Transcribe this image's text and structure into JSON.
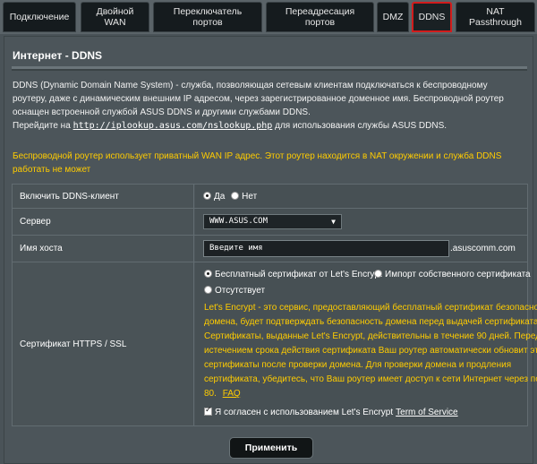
{
  "tabs": [
    {
      "label": "Подключение",
      "active": false
    },
    {
      "label": "Двойной WAN",
      "active": false
    },
    {
      "label": "Переключатель портов",
      "active": false
    },
    {
      "label": "Переадресация портов",
      "active": false
    },
    {
      "label": "DMZ",
      "active": false
    },
    {
      "label": "DDNS",
      "active": true
    },
    {
      "label": "NAT Passthrough",
      "active": false
    }
  ],
  "tab_lines": {
    "t1a": "Двойной",
    "t1b": "WAN",
    "t2a": "Переключатель",
    "t2b": "портов",
    "t3a": "Переадресация",
    "t3b": "портов",
    "t6a": "NAT",
    "t6b": "Passthrough"
  },
  "panel": {
    "title": "Интернет - DDNS",
    "desc_lines": [
      "DDNS (Dynamic Domain Name System) - служба, позволяющая сетевым клиентам подключаться к беспроводному",
      "роутеру, даже с динамическим внешним IP адресом, через зарегистрированное доменное имя. Беспроводной роутер",
      "оснащен встроенной службой ASUS DDNS и другими службами DDNS."
    ],
    "link_prefix": "Перейдите на",
    "link_url": "http://iplookup.asus.com/nslookup.php",
    "link_suffix": "для использования службы ASUS DDNS.",
    "warning_lines": [
      "Беспроводной роутер использует приватный WAN IP адрес. Этот роутер находится в NAT окружении и служба DDNS",
      "работать не может"
    ]
  },
  "form": {
    "enable_label": "Включить DDNS-клиент",
    "enable_yes": "Да",
    "enable_no": "Нет",
    "server_label": "Сервер",
    "server_value": "WWW.ASUS.COM",
    "host_label": "Имя хоста",
    "host_placeholder": "Введите имя",
    "host_suffix": ".asuscomm.com",
    "cert_label": "Сертификат HTTPS / SSL",
    "cert_opt_free": "Бесплатный сертификат от Let's Encrypt",
    "cert_opt_import": "Импорт собственного сертификата",
    "cert_opt_none": "Отсутствует",
    "cert_desc_lines": [
      "Let's Encrypt - это сервис, предоставляющий бесплатный сертификат безопасности",
      "домена, будет подтверждать безопасность домена перед выдачей сертификата.",
      "Сертификаты, выданные Let's Encrypt, действительны в течение 90 дней. Перед",
      "истечением срока действия сертификата Ваш роутер автоматически обновит эти",
      "сертификаты после проверки домена. Для проверки домена и продления",
      "сертификата, убедитесь, что Ваш роутер имеет доступ к сети Интернет через порт",
      "80."
    ],
    "faq_label": "FAQ",
    "agree_label": "Я согласен с использованием Let's Encrypt",
    "tos_label": "Term of Service",
    "apply_label": "Применить"
  },
  "colors": {
    "warning": "#ffcc00",
    "active_tab_border": "#d21c1c"
  }
}
